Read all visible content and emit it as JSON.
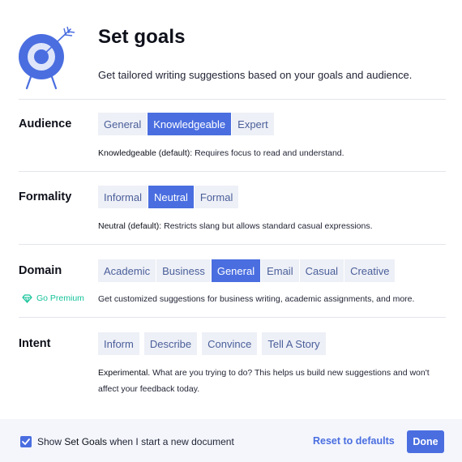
{
  "header": {
    "title": "Set goals",
    "subtitle": "Get tailored writing suggestions based on your goals and audience."
  },
  "audience": {
    "label": "Audience",
    "options": [
      "General",
      "Knowledgeable",
      "Expert"
    ],
    "selected": "Knowledgeable",
    "desc_strong": "Knowledgeable (default):",
    "desc_text": " Requires focus to read and understand."
  },
  "formality": {
    "label": "Formality",
    "options": [
      "Informal",
      "Neutral",
      "Formal"
    ],
    "selected": "Neutral",
    "desc_strong": "Neutral (default):",
    "desc_text": " Restricts slang but allows standard casual expressions."
  },
  "domain": {
    "label": "Domain",
    "options": [
      "Academic",
      "Business",
      "General",
      "Email",
      "Casual",
      "Creative"
    ],
    "selected": "General",
    "premium_label": "Go Premium",
    "desc_text": "Get customized suggestions for business writing, academic assignments, and more."
  },
  "intent": {
    "label": "Intent",
    "options": [
      "Inform",
      "Describe",
      "Convince",
      "Tell A Story"
    ],
    "desc_strong": "Experimental.",
    "desc_text": " What are you trying to do? This helps us build new suggestions and won't affect your feedback today."
  },
  "footer": {
    "show_prefix": "Show ",
    "show_strong": "Set Goals",
    "show_suffix": " when I start a new document",
    "checkbox_checked": true,
    "reset_label": "Reset to defaults",
    "done_label": "Done"
  },
  "colors": {
    "accent": "#4a6ee0",
    "chip_bg": "#eef0f7",
    "premium": "#15c39a"
  }
}
